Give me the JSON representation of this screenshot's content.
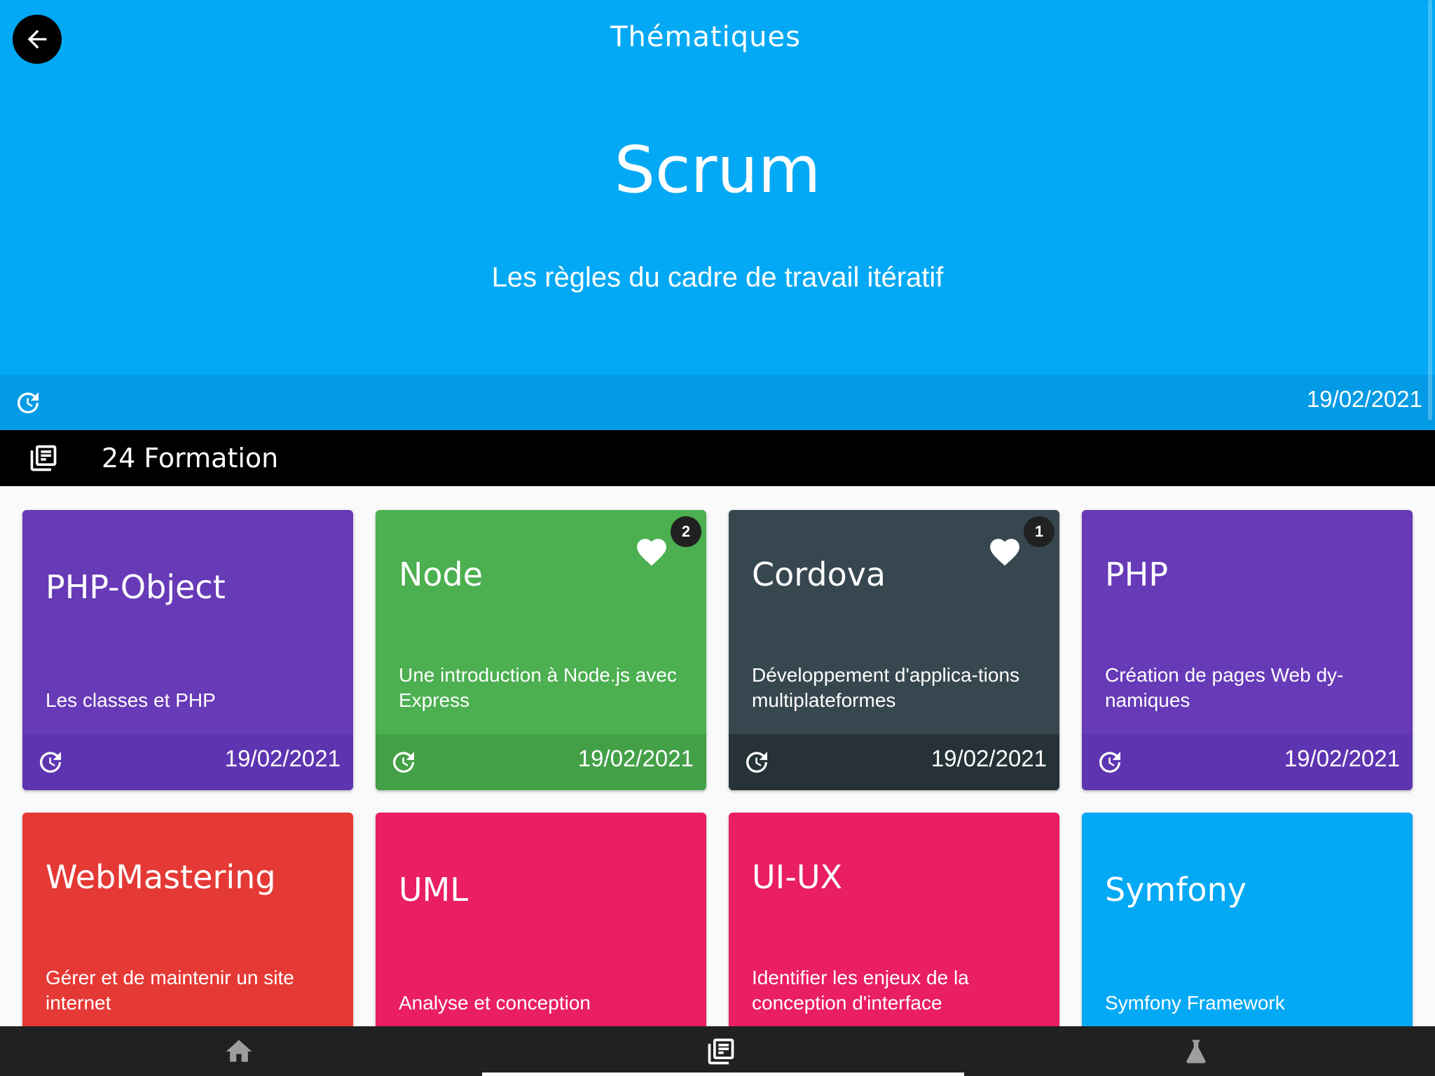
{
  "header": {
    "nav_title": "Thématiques",
    "title": "Scrum",
    "subtitle": "Les règles du cadre de travail itératif",
    "date": "19/02/2021",
    "color": "#03a9f4"
  },
  "section": {
    "title": "24 Formation",
    "icon": "library-books-icon"
  },
  "cards": [
    {
      "title": "PHP-Object",
      "description": "Les classes et PHP",
      "date": "19/02/2021",
      "color": "#673ab7",
      "footer_color": "#5e35b1"
    },
    {
      "title": "Node",
      "description": "Une introduction à Node.js avec Express",
      "date": "19/02/2021",
      "favorites": "2",
      "color": "#4caf50",
      "footer_color": "#43a047"
    },
    {
      "title": "Cordova",
      "description": "Développement d'applica-tions multiplateformes",
      "date": "19/02/2021",
      "favorites": "1",
      "color": "#37474f",
      "footer_color": "#263238"
    },
    {
      "title": "PHP",
      "description": "Création de pages Web dy-namiques",
      "date": "19/02/2021",
      "color": "#673ab7",
      "footer_color": "#5e35b1"
    },
    {
      "title": "WebMastering",
      "description": "Gérer et de maintenir un site internet",
      "color": "#e53935"
    },
    {
      "title": "UML",
      "description": "Analyse et conception",
      "color": "#e91e63"
    },
    {
      "title": "UI-UX",
      "description": "Identifier les enjeux de la conception d'interface",
      "color": "#e91e63"
    },
    {
      "title": "Symfony",
      "description": "Symfony Framework",
      "color": "#03a9f4"
    }
  ],
  "bottom_nav": {
    "items": [
      {
        "name": "home",
        "icon": "home-icon"
      },
      {
        "name": "formations",
        "icon": "library-books-icon",
        "active": true
      },
      {
        "name": "labs",
        "icon": "flask-icon"
      }
    ],
    "background": "#212121"
  }
}
